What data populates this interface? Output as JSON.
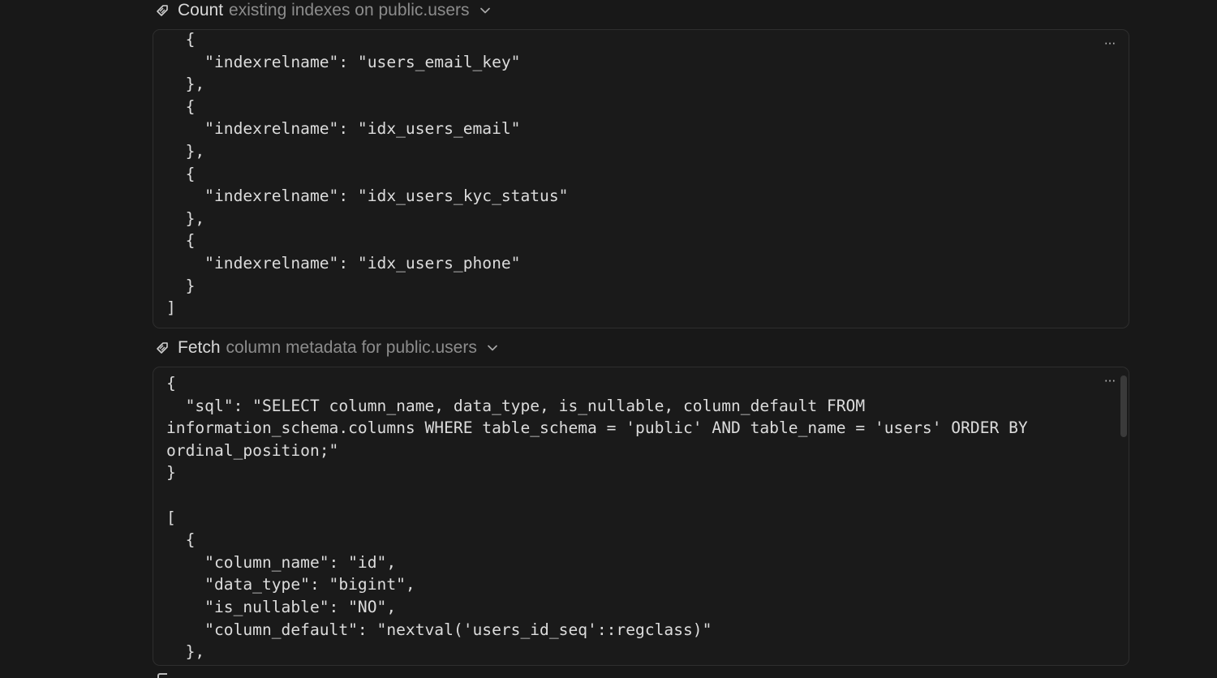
{
  "tool_calls": [
    {
      "verb": "Count",
      "description": "existing indexes on public.users",
      "icon": "pencil-tag-icon",
      "output": "  {\n    \"indexrelname\": \"users_email_key\"\n  },\n  {\n    \"indexrelname\": \"idx_users_email\"\n  },\n  {\n    \"indexrelname\": \"idx_users_kyc_status\"\n  },\n  {\n    \"indexrelname\": \"idx_users_phone\"\n  }\n]",
      "more_label": "···"
    },
    {
      "verb": "Fetch",
      "description": "column metadata for public.users",
      "icon": "pencil-tag-icon",
      "output": "{\n  \"sql\": \"SELECT column_name, data_type, is_nullable, column_default FROM\ninformation_schema.columns WHERE table_schema = 'public' AND table_name = 'users' ORDER BY\nordinal_position;\"\n}\n\n[\n  {\n    \"column_name\": \"id\",\n    \"data_type\": \"bigint\",\n    \"is_nullable\": \"NO\",\n    \"column_default\": \"nextval('users_id_seq'::regclass)\"\n  },",
      "more_label": "···"
    }
  ],
  "colors": {
    "background": "#181818",
    "box_border": "#2e2e2e",
    "text": "#dcdcdc",
    "muted": "#8c8c8c"
  }
}
